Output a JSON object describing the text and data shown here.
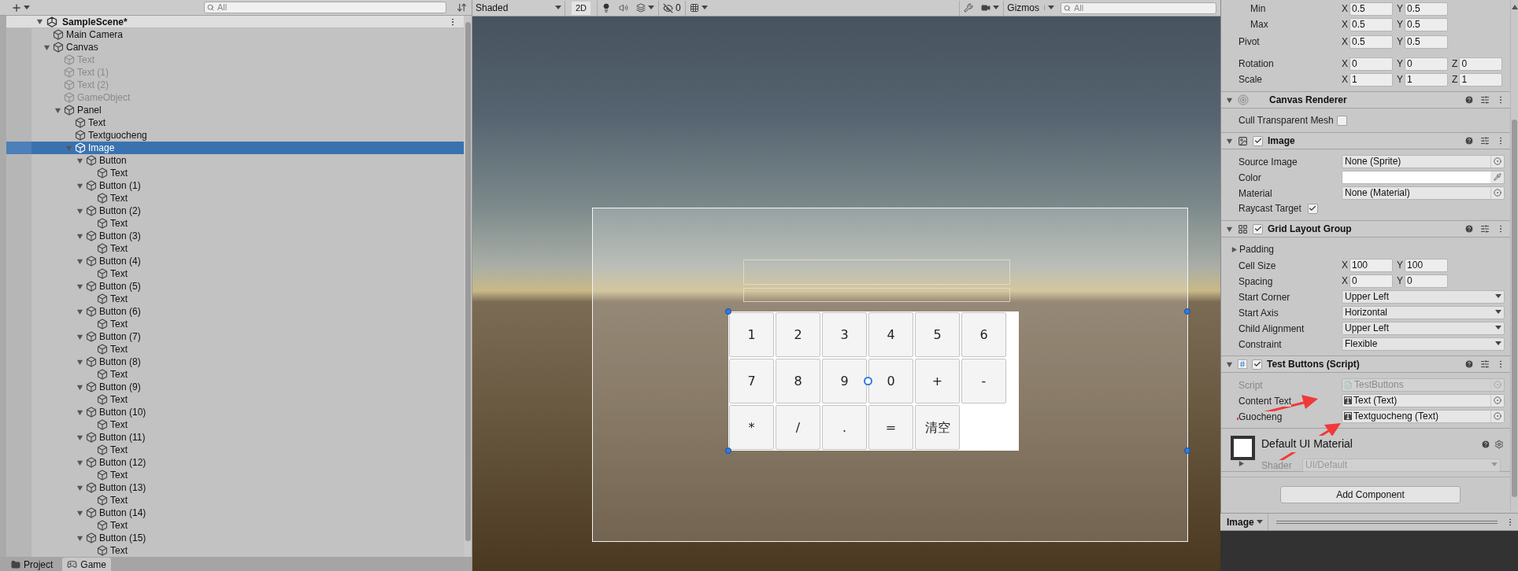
{
  "hierarchy": {
    "search_placeholder": "All",
    "scene": {
      "name": "SampleScene*",
      "expanded": true
    },
    "items": [
      {
        "name": "Main Camera",
        "active": true,
        "selected": false
      },
      {
        "name": "Canvas",
        "active": true,
        "selected": false,
        "expanded": true,
        "children": [
          {
            "name": "Text",
            "active": false,
            "selected": false
          },
          {
            "name": "Text (1)",
            "active": false,
            "selected": false
          },
          {
            "name": "Text (2)",
            "active": false,
            "selected": false
          },
          {
            "name": "GameObject",
            "active": false,
            "selected": false
          },
          {
            "name": "Panel",
            "active": true,
            "selected": false,
            "expanded": true,
            "children": [
              {
                "name": "Text",
                "active": true,
                "selected": false
              },
              {
                "name": "Textguocheng",
                "active": true,
                "selected": false
              },
              {
                "name": "Image",
                "active": true,
                "selected": true,
                "expanded": true,
                "children": [
                  {
                    "name": "Button",
                    "active": true,
                    "selected": false,
                    "expanded": true,
                    "children": [
                      {
                        "name": "Text",
                        "active": true,
                        "selected": false
                      }
                    ]
                  },
                  {
                    "name": "Button (1)",
                    "active": true,
                    "selected": false,
                    "expanded": true,
                    "children": [
                      {
                        "name": "Text",
                        "active": true,
                        "selected": false
                      }
                    ]
                  },
                  {
                    "name": "Button (2)",
                    "active": true,
                    "selected": false,
                    "expanded": true,
                    "children": [
                      {
                        "name": "Text",
                        "active": true,
                        "selected": false
                      }
                    ]
                  },
                  {
                    "name": "Button (3)",
                    "active": true,
                    "selected": false,
                    "expanded": true,
                    "children": [
                      {
                        "name": "Text",
                        "active": true,
                        "selected": false
                      }
                    ]
                  },
                  {
                    "name": "Button (4)",
                    "active": true,
                    "selected": false,
                    "expanded": true,
                    "children": [
                      {
                        "name": "Text",
                        "active": true,
                        "selected": false
                      }
                    ]
                  },
                  {
                    "name": "Button (5)",
                    "active": true,
                    "selected": false,
                    "expanded": true,
                    "children": [
                      {
                        "name": "Text",
                        "active": true,
                        "selected": false
                      }
                    ]
                  },
                  {
                    "name": "Button (6)",
                    "active": true,
                    "selected": false,
                    "expanded": true,
                    "children": [
                      {
                        "name": "Text",
                        "active": true,
                        "selected": false
                      }
                    ]
                  },
                  {
                    "name": "Button (7)",
                    "active": true,
                    "selected": false,
                    "expanded": true,
                    "children": [
                      {
                        "name": "Text",
                        "active": true,
                        "selected": false
                      }
                    ]
                  },
                  {
                    "name": "Button (8)",
                    "active": true,
                    "selected": false,
                    "expanded": true,
                    "children": [
                      {
                        "name": "Text",
                        "active": true,
                        "selected": false
                      }
                    ]
                  },
                  {
                    "name": "Button (9)",
                    "active": true,
                    "selected": false,
                    "expanded": true,
                    "children": [
                      {
                        "name": "Text",
                        "active": true,
                        "selected": false
                      }
                    ]
                  },
                  {
                    "name": "Button (10)",
                    "active": true,
                    "selected": false,
                    "expanded": true,
                    "children": [
                      {
                        "name": "Text",
                        "active": true,
                        "selected": false
                      }
                    ]
                  },
                  {
                    "name": "Button (11)",
                    "active": true,
                    "selected": false,
                    "expanded": true,
                    "children": [
                      {
                        "name": "Text",
                        "active": true,
                        "selected": false
                      }
                    ]
                  },
                  {
                    "name": "Button (12)",
                    "active": true,
                    "selected": false,
                    "expanded": true,
                    "children": [
                      {
                        "name": "Text",
                        "active": true,
                        "selected": false
                      }
                    ]
                  },
                  {
                    "name": "Button (13)",
                    "active": true,
                    "selected": false,
                    "expanded": true,
                    "children": [
                      {
                        "name": "Text",
                        "active": true,
                        "selected": false
                      }
                    ]
                  },
                  {
                    "name": "Button (14)",
                    "active": true,
                    "selected": false,
                    "expanded": true,
                    "children": [
                      {
                        "name": "Text",
                        "active": true,
                        "selected": false
                      }
                    ]
                  },
                  {
                    "name": "Button (15)",
                    "active": true,
                    "selected": false,
                    "expanded": true,
                    "children": [
                      {
                        "name": "Text",
                        "active": true,
                        "selected": false
                      }
                    ]
                  }
                ]
              }
            ]
          }
        ]
      }
    ]
  },
  "bottom_tabs": [
    {
      "label": "Project",
      "kind": "project",
      "selected": false
    },
    {
      "label": "Game",
      "kind": "game",
      "selected": true
    }
  ],
  "scene_toolbar": {
    "shading": "Shaded",
    "mode_2d": "2D",
    "hidden_count": "0",
    "gizmos": "Gizmos",
    "search_placeholder": "All"
  },
  "scene": {
    "calculator_buttons": [
      "1",
      "2",
      "3",
      "4",
      "5",
      "6",
      "7",
      "8",
      "9",
      "0",
      "+",
      "-",
      "*",
      "/",
      ".",
      "=",
      "清空"
    ]
  },
  "inspector": {
    "transform_rows": [
      {
        "label": "Min",
        "indent": true,
        "values": [
          {
            "axis": "X",
            "value": "0.5"
          },
          {
            "axis": "Y",
            "value": "0.5"
          }
        ]
      },
      {
        "label": "Max",
        "indent": true,
        "values": [
          {
            "axis": "X",
            "value": "0.5"
          },
          {
            "axis": "Y",
            "value": "0.5"
          }
        ]
      },
      {
        "label": "Pivot",
        "indent": false,
        "values": [
          {
            "axis": "X",
            "value": "0.5"
          },
          {
            "axis": "Y",
            "value": "0.5"
          }
        ]
      },
      {
        "label": "Rotation",
        "indent": false,
        "values": [
          {
            "axis": "X",
            "value": "0"
          },
          {
            "axis": "Y",
            "value": "0"
          },
          {
            "axis": "Z",
            "value": "0"
          }
        ]
      },
      {
        "label": "Scale",
        "indent": false,
        "values": [
          {
            "axis": "X",
            "value": "1"
          },
          {
            "axis": "Y",
            "value": "1"
          },
          {
            "axis": "Z",
            "value": "1"
          }
        ]
      }
    ],
    "components": [
      {
        "kind": "canvas_renderer",
        "title": "Canvas Renderer",
        "expanded": true,
        "fields": [
          {
            "kind": "checkbox",
            "label": "Cull Transparent Mesh",
            "checked": false
          }
        ]
      },
      {
        "kind": "image",
        "title": "Image",
        "enabled": true,
        "expanded": true,
        "fields": [
          {
            "kind": "object",
            "label": "Source Image",
            "value": "None (Sprite)",
            "disabled": false
          },
          {
            "kind": "color",
            "label": "Color",
            "color": "#ffffff"
          },
          {
            "kind": "object",
            "label": "Material",
            "value": "None (Material)",
            "disabled": false
          },
          {
            "kind": "checkbox",
            "label": "Raycast Target",
            "checked": true
          }
        ]
      },
      {
        "kind": "grid",
        "title": "Grid Layout Group",
        "enabled": true,
        "expanded": true,
        "fields": [
          {
            "kind": "foldout",
            "label": "Padding",
            "expanded": false
          },
          {
            "kind": "vector",
            "label": "Cell Size",
            "values": [
              {
                "axis": "X",
                "value": "100"
              },
              {
                "axis": "Y",
                "value": "100"
              }
            ]
          },
          {
            "kind": "vector",
            "label": "Spacing",
            "values": [
              {
                "axis": "X",
                "value": "0"
              },
              {
                "axis": "Y",
                "value": "0"
              }
            ]
          },
          {
            "kind": "dropdown",
            "label": "Start Corner",
            "value": "Upper Left"
          },
          {
            "kind": "dropdown",
            "label": "Start Axis",
            "value": "Horizontal"
          },
          {
            "kind": "dropdown",
            "label": "Child Alignment",
            "value": "Upper Left"
          },
          {
            "kind": "dropdown",
            "label": "Constraint",
            "value": "Flexible"
          }
        ]
      },
      {
        "kind": "script",
        "title": "Test Buttons (Script)",
        "enabled": true,
        "expanded": true,
        "fields": [
          {
            "kind": "object",
            "label": "Script",
            "value": "TestButtons",
            "disabled": true
          },
          {
            "kind": "object",
            "label": "Content Text",
            "value": "Text (Text)",
            "disabled": false
          },
          {
            "kind": "object",
            "label": "Guocheng",
            "value": "Textguocheng (Text)",
            "disabled": false
          }
        ]
      }
    ],
    "material": {
      "name": "Default UI Material",
      "shader_label": "Shader",
      "shader": "UI/Default"
    },
    "add_component": "Add Component",
    "footer": {
      "label": "Image"
    }
  }
}
